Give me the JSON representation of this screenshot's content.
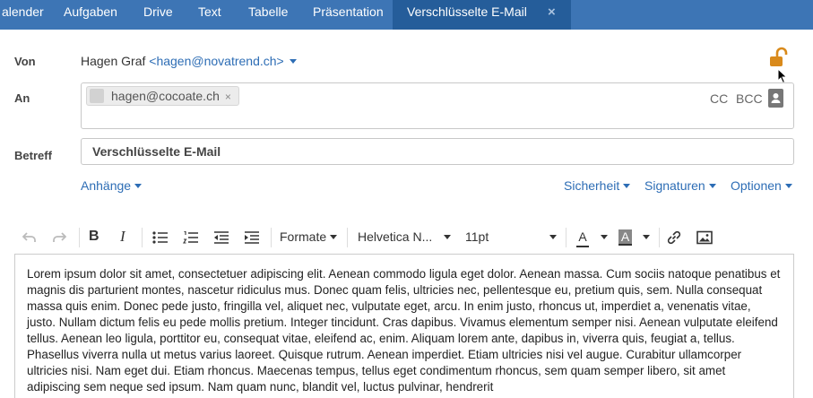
{
  "tabs": [
    {
      "label": "alender",
      "active": false
    },
    {
      "label": "Aufgaben",
      "active": false
    },
    {
      "label": "Drive",
      "active": false
    },
    {
      "label": "Text",
      "active": false
    },
    {
      "label": "Tabelle",
      "active": false
    },
    {
      "label": "Präsentation",
      "active": false
    },
    {
      "label": "Verschlüsselte E-Mail",
      "active": true
    }
  ],
  "tab_close_glyph": "×",
  "compose": {
    "from_label": "Von",
    "from_name": "Hagen Graf",
    "from_address": "<hagen@novatrend.ch>",
    "to_label": "An",
    "to_recipients": [
      {
        "address": "hagen@cocoate.ch",
        "remove": "×"
      }
    ],
    "cc_label": "CC",
    "bcc_label": "BCC",
    "subject_label": "Betreff",
    "subject_value": "Verschlüsselte E-Mail",
    "attachments_label": "Anhänge",
    "security_label": "Sicherheit",
    "signatures_label": "Signaturen",
    "options_label": "Optionen",
    "lock_icon": "unlock-icon",
    "lock_color": "#d98a1b"
  },
  "toolbar": {
    "bold": "B",
    "italic": "I",
    "formats_label": "Formate",
    "font_family_value": "Helvetica N...",
    "font_size_value": "11pt",
    "text_color_glyph": "A",
    "bg_color_glyph": "A"
  },
  "body_text": "Lorem ipsum dolor sit amet, consectetuer adipiscing elit. Aenean commodo ligula eget dolor. Aenean massa. Cum sociis natoque penatibus et magnis dis parturient montes, nascetur ridiculus mus. Donec quam felis, ultricies nec, pellentesque eu, pretium quis, sem. Nulla consequat massa quis enim. Donec pede justo, fringilla vel, aliquet nec, vulputate eget, arcu. In enim justo, rhoncus ut, imperdiet a, venenatis vitae, justo. Nullam dictum felis eu pede mollis pretium. Integer tincidunt. Cras dapibus. Vivamus elementum semper nisi. Aenean vulputate eleifend tellus. Aenean leo ligula, porttitor eu, consequat vitae, eleifend ac, enim. Aliquam lorem ante, dapibus in, viverra quis, feugiat a, tellus. Phasellus viverra nulla ut metus varius laoreet. Quisque rutrum. Aenean imperdiet. Etiam ultricies nisi vel augue. Curabitur ullamcorper ultricies nisi. Nam eget dui. Etiam rhoncus. Maecenas tempus, tellus eget condimentum rhoncus, sem quam semper libero, sit amet adipiscing sem neque sed ipsum. Nam quam nunc, blandit vel, luctus pulvinar, hendrerit",
  "colors": {
    "tabbar": "#3d75b5",
    "tab_active": "#255d9a",
    "link": "#2d6db5"
  }
}
